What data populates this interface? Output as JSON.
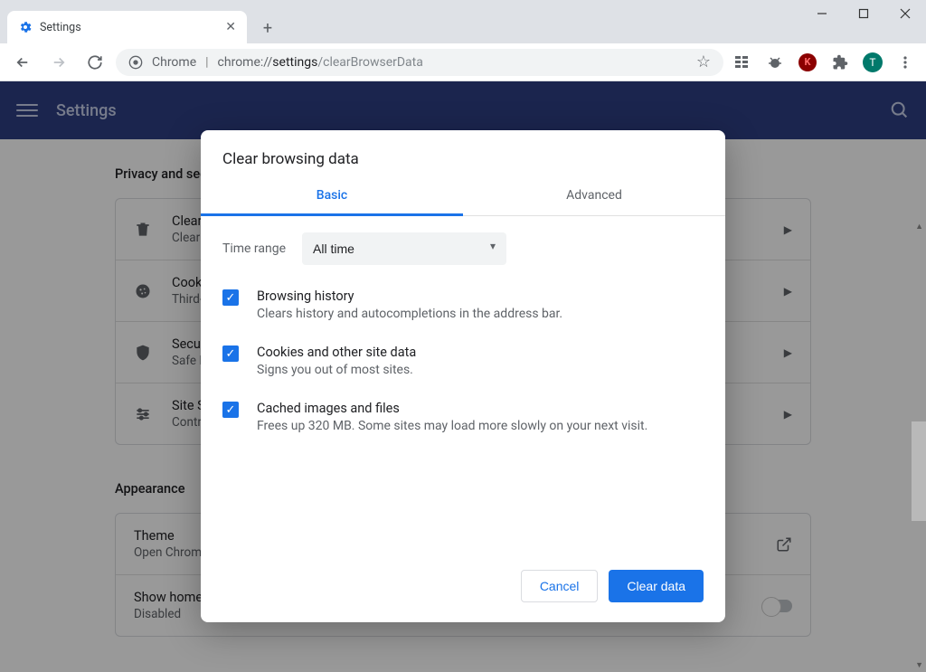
{
  "tab": {
    "title": "Settings"
  },
  "omnibox": {
    "host_label": "Chrome",
    "url_strong": "settings",
    "url_rest": "/clearBrowserData",
    "full_prefix": "chrome://"
  },
  "header": {
    "title": "Settings"
  },
  "sections": {
    "privacy_heading": "Privacy and security",
    "appearance_heading": "Appearance",
    "privacy_rows": [
      {
        "title": "Clear browsing data",
        "subtitle": "Clear history, cookies, cache, and more"
      },
      {
        "title": "Cookies and other site data",
        "subtitle": "Third-party cookies are blocked in Incognito mode"
      },
      {
        "title": "Security",
        "subtitle": "Safe Browsing (protection from dangerous sites) and other security settings"
      },
      {
        "title": "Site Settings",
        "subtitle": "Controls what information sites can use and show"
      }
    ],
    "appearance_rows": [
      {
        "title": "Theme",
        "subtitle": "Open Chrome Web Store"
      },
      {
        "title": "Show home button",
        "subtitle": "Disabled"
      }
    ]
  },
  "dialog": {
    "title": "Clear browsing data",
    "tab_basic": "Basic",
    "tab_advanced": "Advanced",
    "time_label": "Time range",
    "time_value": "All time",
    "items": [
      {
        "title": "Browsing history",
        "desc": "Clears history and autocompletions in the address bar."
      },
      {
        "title": "Cookies and other site data",
        "desc": "Signs you out of most sites."
      },
      {
        "title": "Cached images and files",
        "desc": "Frees up 320 MB. Some sites may load more slowly on your next visit."
      }
    ],
    "cancel_label": "Cancel",
    "clear_label": "Clear data"
  }
}
